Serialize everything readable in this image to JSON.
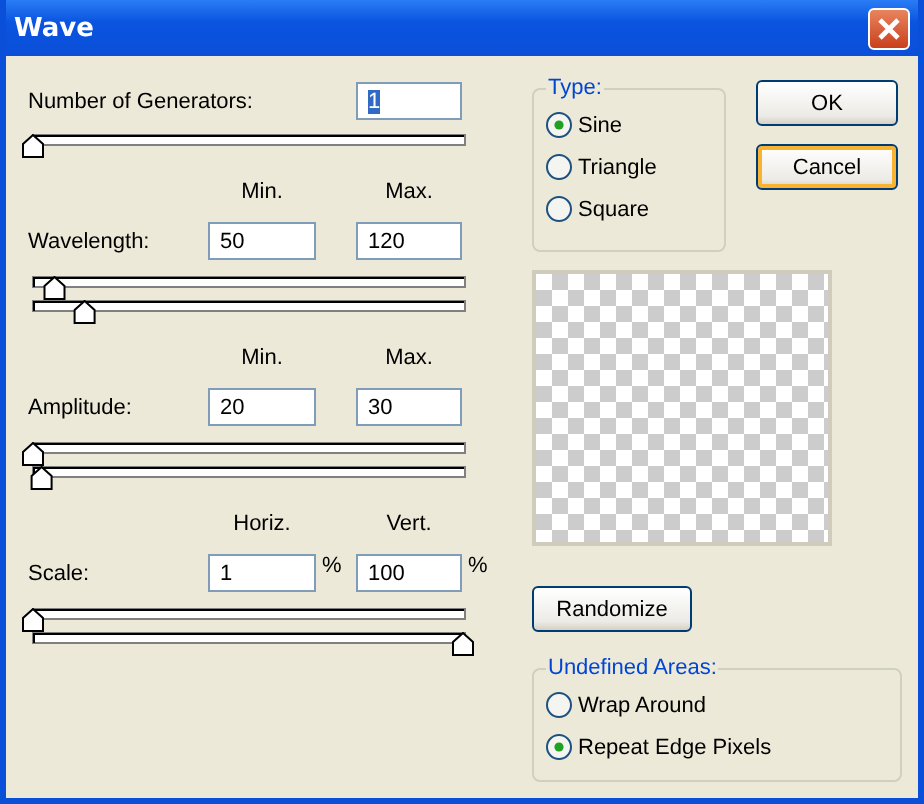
{
  "window": {
    "title": "Wave"
  },
  "generators": {
    "label": "Number of Generators:",
    "value": "1",
    "text_selected": true,
    "sliders": [
      {
        "level": 0
      }
    ]
  },
  "sections": [
    {
      "headers": [
        "Min.",
        "Max."
      ],
      "label": "Wavelength:",
      "fields": [
        {
          "value": "50"
        },
        {
          "value": "120"
        }
      ],
      "sliders": [
        {
          "level": 0.05
        },
        {
          "level": 0.12
        }
      ]
    },
    {
      "headers": [
        "Min.",
        "Max."
      ],
      "label": "Amplitude:",
      "fields": [
        {
          "value": "20"
        },
        {
          "value": "30"
        }
      ],
      "sliders": [
        {
          "level": 0
        },
        {
          "level": 0.02
        }
      ]
    },
    {
      "headers": [
        "Horiz.",
        "Vert."
      ],
      "label": "Scale:",
      "fields": [
        {
          "value": "1",
          "unit": "%"
        },
        {
          "value": "100",
          "unit": "%"
        }
      ],
      "sliders": [
        {
          "level": 0
        },
        {
          "level": 1
        }
      ]
    }
  ],
  "type_group": {
    "title": "Type:",
    "options": [
      {
        "label": "Sine",
        "selected": true
      },
      {
        "label": "Triangle",
        "selected": false
      },
      {
        "label": "Square",
        "selected": false
      }
    ]
  },
  "buttons": [
    {
      "label": "OK",
      "hovered": false
    },
    {
      "label": "Cancel",
      "hovered": true
    }
  ],
  "randomize_button": "Randomize",
  "undefined_areas": {
    "title": "Undefined Areas:",
    "options": [
      {
        "label": "Wrap Around",
        "selected": false
      },
      {
        "label": "Repeat Edge Pixels",
        "selected": true
      }
    ]
  }
}
